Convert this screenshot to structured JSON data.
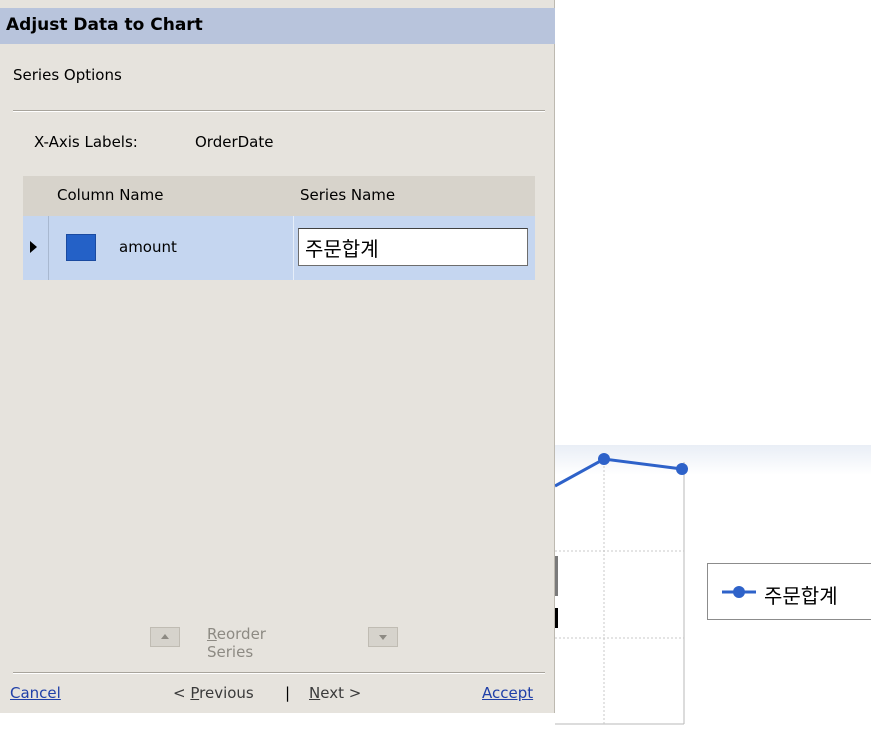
{
  "dialog": {
    "title": "Adjust Data to Chart",
    "section_heading": "Series Options",
    "x_axis_label": "X-Axis Labels:",
    "x_axis_value": "OrderDate",
    "grid": {
      "columns": [
        "Column Name",
        "Series Name"
      ],
      "rows": [
        {
          "column_name": "amount",
          "series_name": "주문합계",
          "swatch_color": "#2461c7"
        }
      ]
    },
    "reorder_label_access_key": "R",
    "reorder_label_rest": "eorder Series",
    "footer": {
      "cancel_key": "C",
      "cancel_rest": "ancel",
      "previous_prefix": "< ",
      "previous_key": "P",
      "previous_rest": "revious",
      "separator": "|",
      "next_key": "N",
      "next_rest": "ext >",
      "accept": "Accept"
    }
  },
  "chart": {
    "legend_label": "주문합계",
    "series_color": "#2e62c9",
    "grid_color": "#c8c8c8"
  }
}
